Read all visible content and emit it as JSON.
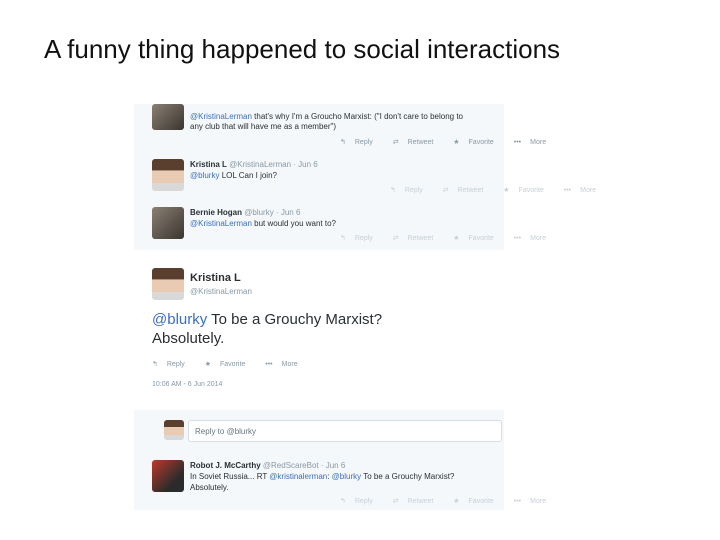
{
  "slide": {
    "title": "A funny thing happened to social interactions"
  },
  "tweets": {
    "t0": {
      "text_handle": "@KristinaLerman",
      "text_rest_1": " that's why I'm a Groucho Marxist: (\"I don't care to belong to",
      "text_line_2": "any club that will have me as a member\")",
      "actions": {
        "reply": "Reply",
        "retweet": "Retweet",
        "favorite": "Favorite",
        "more": "More"
      }
    },
    "t1": {
      "name": "Kristina L",
      "handle_time": "@KristinaLerman · Jun 6",
      "text_handle": "@blurky",
      "text_rest": " LOL Can I join?",
      "actions": {
        "reply": "Reply",
        "retweet": "Retweet",
        "favorite": "Favorite",
        "more": "More"
      }
    },
    "t2": {
      "name": "Bernie Hogan",
      "handle_time": "@blurky · Jun 6",
      "text_handle": "@KristinaLerman",
      "text_rest": " but would you want to?",
      "actions": {
        "reply": "Reply",
        "retweet": "Retweet",
        "favorite": "Favorite",
        "more": "More"
      }
    },
    "main": {
      "name": "Kristina L",
      "handle": "@KristinaLerman",
      "text_handle": "@blurky",
      "text_rest": " To be a Grouchy Marxist?",
      "text_line_2": "Absolutely.",
      "actions": {
        "reply": "Reply",
        "favorite": "Favorite",
        "more": "More"
      },
      "timestamp": "10:06 AM - 6 Jun 2014"
    },
    "reply": {
      "placeholder": "Reply to @blurky"
    },
    "t3": {
      "name": "Robot J. McCarthy",
      "handle_time": "@RedScareBot · Jun 6",
      "text_pre": "In Soviet Russia... RT ",
      "text_handle_1": "@kristinalerman",
      "text_mid": ": ",
      "text_handle_2": "@blurky",
      "text_rest": " To be a Grouchy Marxist?",
      "text_line_2": "Absolutely.",
      "actions": {
        "reply": "Reply",
        "retweet": "Retweet",
        "favorite": "Favorite",
        "more": "More"
      }
    }
  },
  "icons": {
    "reply": "↰",
    "retweet": "⇄",
    "favorite": "★",
    "more": "•••"
  },
  "colors": {
    "link": "#3b6fbf",
    "meta": "#8899a6",
    "panel": "#f5f8fa"
  }
}
